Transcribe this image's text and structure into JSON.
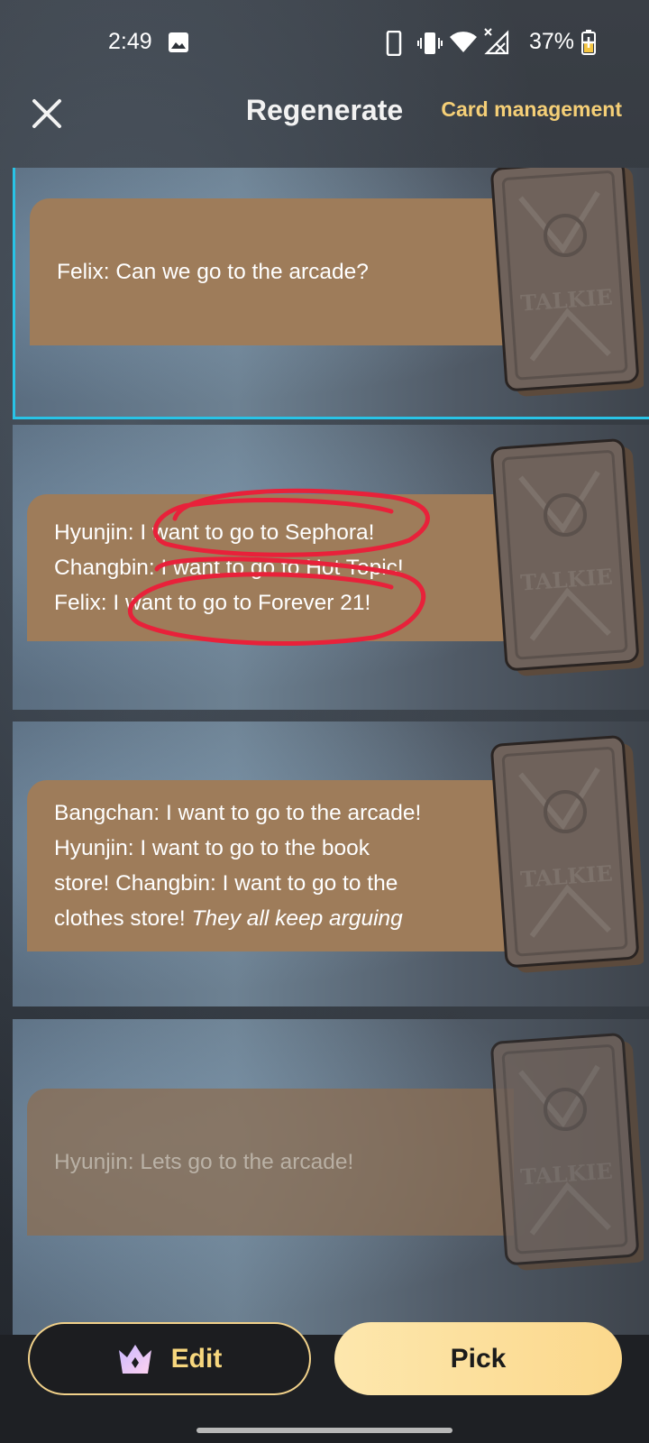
{
  "status_bar": {
    "time": "2:49",
    "battery_percent": "37%"
  },
  "header": {
    "title": "Regenerate",
    "card_management_label": "Card management"
  },
  "options": [
    {
      "lines": [
        "Felix: Can we go to the arcade?"
      ],
      "selected": true
    },
    {
      "lines": [
        "Hyunjin: I want to go to Sephora!",
        "Changbin: I want to go to Hot Topic!",
        "Felix: I want to go to Forever 21!"
      ],
      "selected": false
    },
    {
      "line1": "Bangchan: I want to go to the arcade!",
      "line2": "Hyunjin: I want to go to the book",
      "line3": "store! Changbin: I want to go to the",
      "line4_plain": "clothes store! ",
      "line4_italic": "They all keep arguing",
      "selected": false
    },
    {
      "lines": [
        "Hyunjin: Lets go to the arcade!"
      ],
      "selected": false
    }
  ],
  "card_art_text": "TALKIE",
  "actions": {
    "edit_label": "Edit",
    "pick_label": "Pick"
  },
  "colors": {
    "accent_gold": "#f5cf77",
    "selection_border": "#29c3e6",
    "annotation_red": "#e8213a",
    "bubble_brown": "#9e7c5a"
  },
  "icons": {
    "close": "close-icon",
    "crown": "crown-icon"
  }
}
